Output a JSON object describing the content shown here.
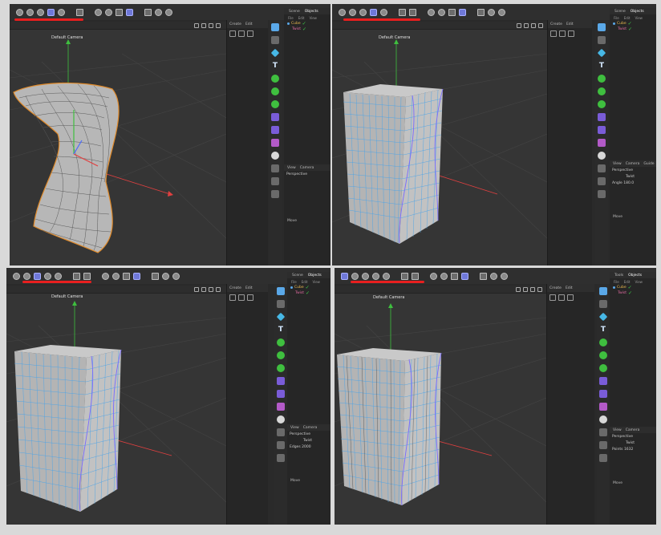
{
  "viewport": {
    "camera_label": "Default Camera",
    "camera_icon": "camera-icon"
  },
  "panes": [
    {
      "id": "top-left",
      "object_tabs": [
        "Scene",
        "Objects"
      ],
      "object_menu": [
        "File",
        "Edit",
        "View"
      ],
      "objects": [
        {
          "name": "Cube",
          "color": "#e9b84c"
        },
        {
          "name": "Twist",
          "color": "#e06aa0"
        }
      ],
      "side_tabs": [
        "Create",
        "Edit"
      ],
      "attr_tabs": [
        "View",
        "Camera"
      ],
      "attr_lines": [
        "Perspective"
      ],
      "move_label": "Move"
    },
    {
      "id": "top-right",
      "object_tabs": [
        "Scene",
        "Objects"
      ],
      "object_menu": [
        "File",
        "Edit",
        "View"
      ],
      "objects": [
        {
          "name": "Cube",
          "color": "#e9b84c"
        },
        {
          "name": "Twist",
          "color": "#e06aa0"
        }
      ],
      "side_tabs": [
        "Create",
        "Edit"
      ],
      "attr_tabs": [
        "View",
        "Camera",
        "Guide"
      ],
      "attr_lines": [
        "Perspective",
        "Twist",
        "Angle  180.0"
      ],
      "move_label": "Move"
    },
    {
      "id": "bottom-left",
      "object_tabs": [
        "Scene",
        "Objects"
      ],
      "object_menu": [
        "File",
        "Edit",
        "View"
      ],
      "objects": [
        {
          "name": "Cube",
          "color": "#e9b84c"
        },
        {
          "name": "Twist",
          "color": "#e06aa0"
        }
      ],
      "side_tabs": [
        "Create",
        "Edit"
      ],
      "attr_tabs": [
        "View",
        "Camera"
      ],
      "attr_lines": [
        "Perspective",
        "Twist",
        "Edges  2000"
      ],
      "move_label": "Move"
    },
    {
      "id": "bottom-right",
      "object_tabs": [
        "Tools",
        "Objects"
      ],
      "object_menu": [
        "File",
        "Edit",
        "View"
      ],
      "objects": [
        {
          "name": "Cube",
          "color": "#e9b84c"
        },
        {
          "name": "Twist",
          "color": "#e06aa0"
        }
      ],
      "side_tabs": [
        "Create",
        "Edit"
      ],
      "attr_tabs": [
        "View",
        "Camera"
      ],
      "attr_lines": [
        "Perspective",
        "Twist",
        "Points  1632"
      ],
      "move_label": "Move"
    }
  ],
  "colors": {
    "accent": "#6f78d8",
    "annotation_red": "#e81f1f",
    "axis_y": "#3fbf3f",
    "axis_x": "#e04040",
    "mesh_wire": "#4aa3e8",
    "mesh_face": "#b8b8b8",
    "selection_outline": "#e08a2a"
  }
}
